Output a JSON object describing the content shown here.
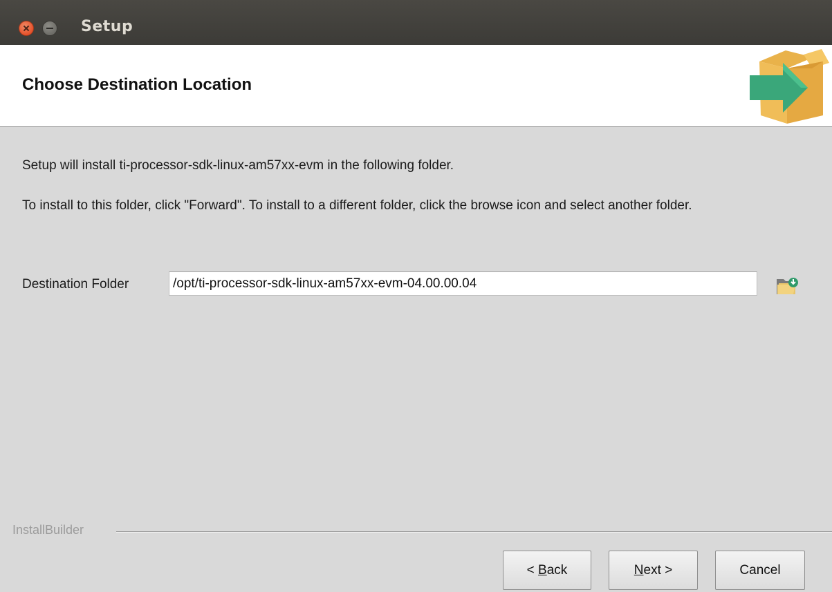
{
  "window": {
    "title": "Setup"
  },
  "header": {
    "title": "Choose Destination Location",
    "icon": "install-box-arrow-icon"
  },
  "main": {
    "intro_text": "Setup will install ti-processor-sdk-linux-am57xx-evm in the following folder.",
    "instruction_text": "To install to this folder, click \"Forward\". To install to a different folder, click the browse icon and select another folder.",
    "destination_label": "Destination Folder",
    "destination_value": "/opt/ti-processor-sdk-linux-am57xx-evm-04.00.00.04",
    "browse_icon": "folder-browse-icon"
  },
  "footer": {
    "brand": "InstallBuilder",
    "back_prefix": "< ",
    "back_mnemonic": "B",
    "back_rest": "ack",
    "next_mnemonic": "N",
    "next_rest": "ext >",
    "cancel_label": "Cancel"
  },
  "colors": {
    "titlebar": "#3c3b37",
    "close_button": "#e5522b",
    "body_background": "#d9d9d9",
    "header_background": "#ffffff",
    "icon_box": "#f2c15a",
    "icon_arrow": "#3aa77a"
  }
}
